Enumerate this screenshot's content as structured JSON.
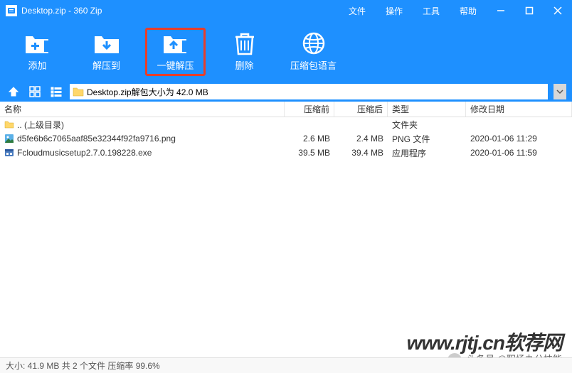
{
  "titlebar": {
    "title": "Desktop.zip - 360 Zip"
  },
  "menu": {
    "file": "文件",
    "action": "操作",
    "tools": "工具",
    "help": "帮助"
  },
  "toolbar": {
    "add": "添加",
    "extract_to": "解压到",
    "one_click": "一键解压",
    "delete": "删除",
    "language": "压缩包语言"
  },
  "path": {
    "text": "Desktop.zip解包大小为 42.0 MB"
  },
  "columns": {
    "name": "名称",
    "before": "压缩前",
    "after": "压缩后",
    "type": "类型",
    "date": "修改日期"
  },
  "files": [
    {
      "name": ".. (上级目录)",
      "before": "",
      "after": "",
      "type": "文件夹",
      "date": "",
      "icon": "folder"
    },
    {
      "name": "d5fe6b6c7065aaf85e32344f92fa9716.png",
      "before": "2.6 MB",
      "after": "2.4 MB",
      "type": "PNG 文件",
      "date": "2020-01-06 11:29",
      "icon": "image"
    },
    {
      "name": "Fcloudmusicsetup2.7.0.198228.exe",
      "before": "39.5 MB",
      "after": "39.4 MB",
      "type": "应用程序",
      "date": "2020-01-06 11:59",
      "icon": "exe"
    }
  ],
  "statusbar": {
    "text": "大小: 41.9 MB 共 2 个文件 压缩率 99.6%"
  },
  "watermark": {
    "main": "www.rjtj.cn软荐网",
    "sub": "头条号 @职场办公技能"
  }
}
